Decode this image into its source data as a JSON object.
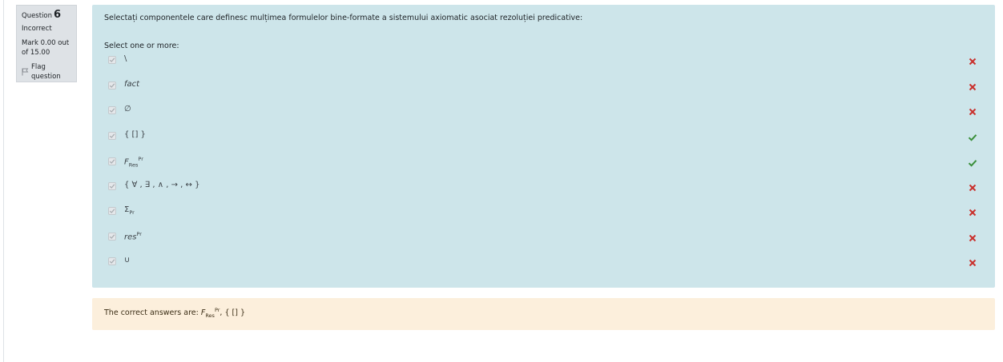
{
  "info": {
    "question_label": "Question",
    "question_number": "6",
    "state": "Incorrect",
    "grade_line1": "Mark 0.00 out",
    "grade_line2": "of 15.00",
    "flag_label": "Flag question"
  },
  "question": {
    "text": "Selectați componentele care definesc mulțimea formulelor bine-formate a sistemului axiomatic asociat rezoluției predicative:",
    "prompt": "Select one or more:",
    "options": [
      {
        "main": "\\",
        "sub": "",
        "sup": "",
        "italic": false,
        "checked": true,
        "feedback": "incorrect"
      },
      {
        "main": "fact",
        "sub": "",
        "sup": "",
        "italic": true,
        "checked": true,
        "feedback": "incorrect"
      },
      {
        "main": "∅",
        "sub": "",
        "sup": "",
        "italic": false,
        "checked": true,
        "feedback": "incorrect"
      },
      {
        "main": "{ [] }",
        "sub": "",
        "sup": "",
        "italic": false,
        "checked": true,
        "feedback": "correct"
      },
      {
        "main": "F",
        "sub": "Res",
        "sup": "Pr",
        "italic": true,
        "checked": true,
        "feedback": "correct"
      },
      {
        "main": "{ ∀ , ∃ , ∧ , → , ↔ }",
        "sub": "",
        "sup": "",
        "italic": false,
        "checked": true,
        "feedback": "incorrect"
      },
      {
        "main": "Σ",
        "sub": "Pr",
        "sup": "",
        "italic": false,
        "checked": true,
        "feedback": "incorrect"
      },
      {
        "main": "res",
        "sub": "",
        "sup": "Pr",
        "italic": true,
        "checked": true,
        "feedback": "incorrect"
      },
      {
        "main": "∪",
        "sub": "",
        "sup": "",
        "italic": false,
        "checked": true,
        "feedback": "incorrect"
      }
    ]
  },
  "right_answer": {
    "prefix": "The correct answers are: ",
    "ans1_main": "F",
    "ans1_sub": "Res",
    "ans1_sup": "Pr",
    "separator": ", ",
    "ans2": "{ [] }"
  },
  "colors": {
    "correct": "#3a8f3a",
    "incorrect": "#c9302c",
    "formulation_bg": "#cde5ea",
    "rightanswer_bg": "#fcefdc"
  }
}
